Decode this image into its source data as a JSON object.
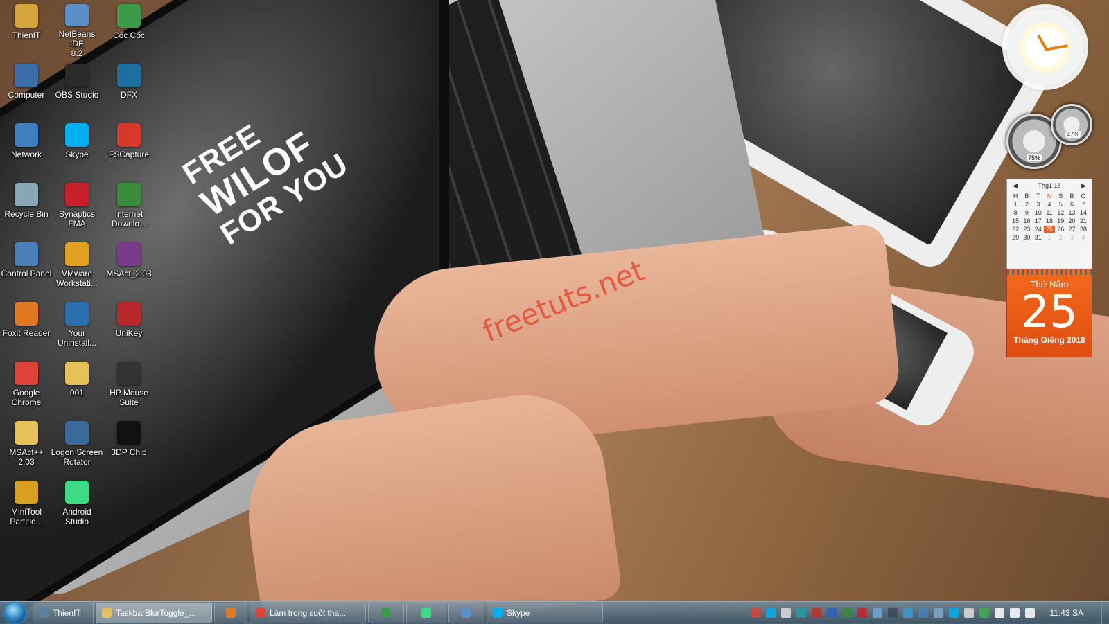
{
  "wallpaper": {
    "laptop_text_lines": [
      "FREE",
      "WILOF",
      "FOR YOU"
    ],
    "watermark": "freetuts.net"
  },
  "desktop_icons": [
    {
      "label": "ThienIT",
      "icon": "folder-user-icon",
      "color": "#d6a63c"
    },
    {
      "label": "NetBeans IDE\n8.2",
      "icon": "netbeans-icon",
      "color": "#5b8fc7"
    },
    {
      "label": "Cốc Cốc",
      "icon": "coccoc-browser-icon",
      "color": "#3a9a4a"
    },
    {
      "label": "Computer",
      "icon": "computer-icon",
      "color": "#3b6ea8"
    },
    {
      "label": "OBS Studio",
      "icon": "obs-icon",
      "color": "#2a2a2a"
    },
    {
      "label": "DFX",
      "icon": "dfx-audio-icon",
      "color": "#1f6ea0"
    },
    {
      "label": "Network",
      "icon": "network-icon",
      "color": "#3f7fbf"
    },
    {
      "label": "Skype",
      "icon": "skype-icon",
      "color": "#00aff0"
    },
    {
      "label": "FSCapture",
      "icon": "fscapture-icon",
      "color": "#d8382c"
    },
    {
      "label": "Recycle Bin",
      "icon": "recycle-bin-icon",
      "color": "#8aa4b8"
    },
    {
      "label": "Synaptics\nFMA",
      "icon": "synaptics-icon",
      "color": "#c8202a"
    },
    {
      "label": "Internet\nDownlo...",
      "icon": "idm-icon",
      "color": "#3a8a3a"
    },
    {
      "label": "Control Panel",
      "icon": "control-panel-icon",
      "color": "#4a7fb8"
    },
    {
      "label": "VMware\nWorkstati...",
      "icon": "vmware-icon",
      "color": "#e0a020"
    },
    {
      "label": "MSAct_2.03",
      "icon": "winrar-archive-icon",
      "color": "#7a3a8a"
    },
    {
      "label": "Foxit Reader",
      "icon": "foxit-reader-icon",
      "color": "#e07820"
    },
    {
      "label": "Your\nUninstall...",
      "icon": "uninstaller-icon",
      "color": "#2a6fb0"
    },
    {
      "label": "UniKey",
      "icon": "unikey-icon",
      "color": "#b8282a"
    },
    {
      "label": "Google\nChrome",
      "icon": "chrome-icon",
      "color": "#db4437"
    },
    {
      "label": "001",
      "icon": "folder-icon",
      "color": "#e6c15a"
    },
    {
      "label": "HP Mouse\nSuite",
      "icon": "mouse-icon",
      "color": "#333333"
    },
    {
      "label": "MSAct++\n2.03",
      "icon": "folder-icon",
      "color": "#e6c15a"
    },
    {
      "label": "Logon Screen\nRotator",
      "icon": "logon-screen-icon",
      "color": "#3a6a9a"
    },
    {
      "label": "3DP Chip",
      "icon": "3dp-chip-icon",
      "color": "#111111"
    },
    {
      "label": "MiniTool\nPartitio...",
      "icon": "minitool-partition-icon",
      "color": "#d8a020"
    },
    {
      "label": "Android\nStudio",
      "icon": "android-studio-icon",
      "color": "#3ddc84"
    }
  ],
  "gadgets": {
    "clock": {
      "icon": "analog-clock-icon"
    },
    "cpu_meter": {
      "cpu_percent": "75%",
      "memory_percent": "47%"
    },
    "calendar_mini": {
      "month_label": "Thg1 18",
      "prev": "◀",
      "next": "▶",
      "weekday_headers": [
        "H",
        "B",
        "T",
        "N",
        "S",
        "B",
        "C"
      ],
      "weeks": [
        [
          "1",
          "2",
          "3",
          "4",
          "5",
          "6",
          "7"
        ],
        [
          "8",
          "9",
          "10",
          "11",
          "12",
          "13",
          "14"
        ],
        [
          "15",
          "16",
          "17",
          "18",
          "19",
          "20",
          "21"
        ],
        [
          "22",
          "23",
          "24",
          "25",
          "26",
          "27",
          "28"
        ],
        [
          "29",
          "30",
          "31",
          "1",
          "2",
          "3",
          "4"
        ]
      ],
      "today": "25"
    },
    "calendar_big": {
      "weekday": "Thứ Năm",
      "day": "25",
      "month_year": "Tháng Giêng 2018"
    }
  },
  "taskbar": {
    "start_icon": "windows-start-orb-icon",
    "items": [
      {
        "label": "ThienIT",
        "icon": "user-folder-icon",
        "color": "#5a7fa0",
        "active": false
      },
      {
        "label": "TaskbarBlurToggle_...",
        "icon": "folder-icon",
        "color": "#e6c15a",
        "active": true
      },
      {
        "label": "",
        "icon": "media-player-icon",
        "color": "#e07820",
        "active": false
      },
      {
        "label": "Làm trong suốt tha...",
        "icon": "chrome-icon",
        "color": "#db4437",
        "active": false
      },
      {
        "label": "",
        "icon": "coccoc-browser-icon",
        "color": "#3a9a4a",
        "active": false
      },
      {
        "label": "",
        "icon": "android-studio-icon",
        "color": "#3ddc84",
        "active": false
      },
      {
        "label": "",
        "icon": "netbeans-icon",
        "color": "#5b8fc7",
        "active": false
      },
      {
        "label": "Skype",
        "icon": "skype-icon",
        "color": "#00aff0",
        "active": false
      }
    ],
    "tray_icons": [
      {
        "icon": "tray-chrome-icon",
        "color": "#db4437"
      },
      {
        "icon": "tray-skype-icon",
        "color": "#00aff0"
      },
      {
        "icon": "tray-network-share-icon",
        "color": "#dddddd"
      },
      {
        "icon": "tray-fx-icon",
        "color": "#1fa0a0"
      },
      {
        "icon": "tray-v-icon",
        "color": "#c0302a"
      },
      {
        "icon": "tray-bluetooth-icon",
        "color": "#2a5fc0"
      },
      {
        "icon": "tray-idm-icon",
        "color": "#3a8a3a"
      },
      {
        "icon": "tray-synaptics-icon",
        "color": "#c8202a"
      },
      {
        "icon": "tray-cloud-icon",
        "color": "#6aa8d8"
      },
      {
        "icon": "tray-monitor-icon",
        "color": "#3a4a5a"
      },
      {
        "icon": "tray-update-icon",
        "color": "#3a9ad0"
      },
      {
        "icon": "tray-app-icon",
        "color": "#4a7fb8"
      },
      {
        "icon": "tray-vmware-icon",
        "color": "#7aa8c8"
      },
      {
        "icon": "tray-skype2-icon",
        "color": "#00aff0"
      },
      {
        "icon": "tray-usb-icon",
        "color": "#dddddd"
      },
      {
        "icon": "tray-security-icon",
        "color": "#3ab04a"
      },
      {
        "icon": "tray-signal-icon",
        "color": "#ffffff"
      },
      {
        "icon": "tray-volume-icon",
        "color": "#ffffff"
      },
      {
        "icon": "tray-flag-icon",
        "color": "#ffffff"
      }
    ],
    "time": "11:43 SA"
  }
}
